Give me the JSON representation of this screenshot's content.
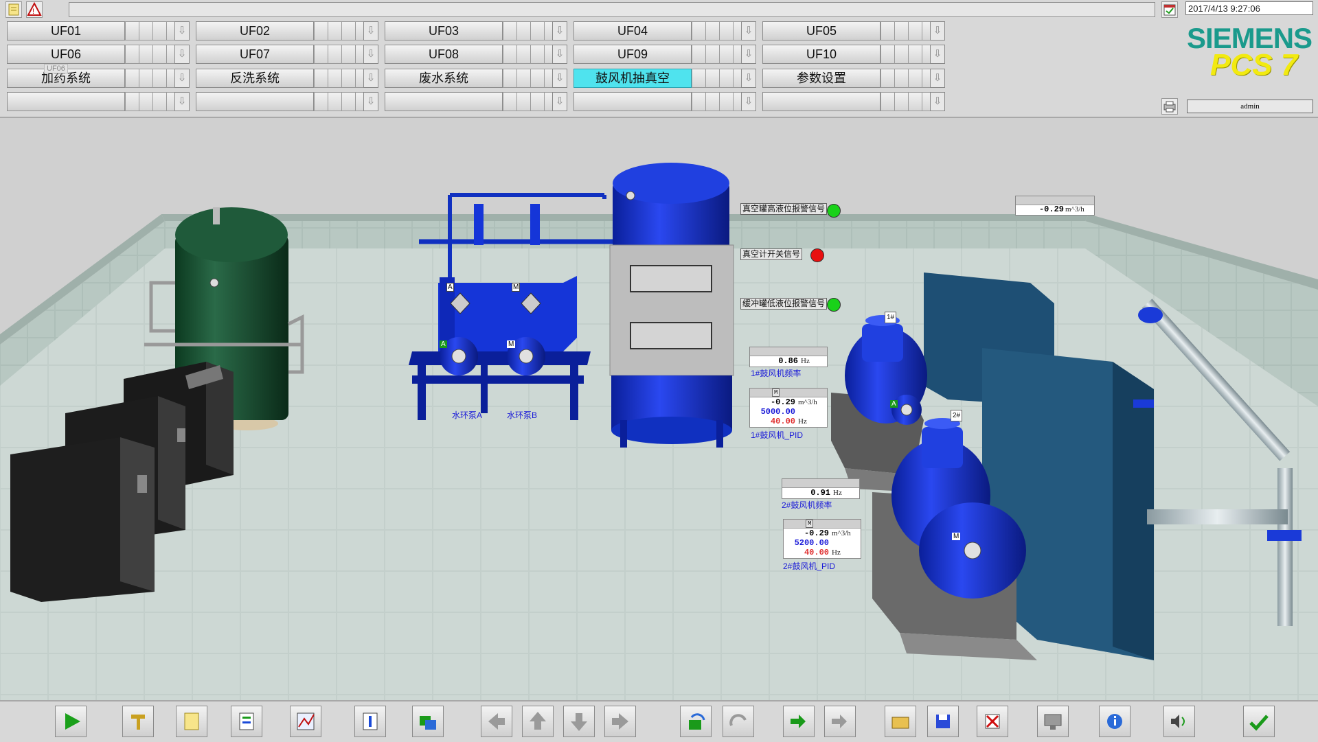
{
  "header": {
    "datetime": "2017/4/13 9:27:06",
    "user": "admin",
    "brand": "SIEMENS",
    "product": "PCS 7",
    "ghost_label": "UF06",
    "rows": [
      [
        "UF01",
        "UF02",
        "UF03",
        "UF04",
        "UF05"
      ],
      [
        "UF06",
        "UF07",
        "UF08",
        "UF09",
        "UF10"
      ],
      [
        "加药系统",
        "反洗系统",
        "废水系统",
        "鼓风机抽真空",
        "参数设置"
      ],
      [
        "",
        "",
        "",
        "",
        ""
      ]
    ],
    "active_button": "鼓风机抽真空"
  },
  "plant": {
    "signals": {
      "vacuum_high_level": "真空罐高液位报警信号",
      "vacuum_switch": "真空计开关信号",
      "buffer_low_level": "缓冲罐低液位报警信号"
    },
    "signal_colors": {
      "green": "#19d219",
      "red": "#e81010"
    },
    "pump_a_label": "水环泵A",
    "pump_b_label": "水环泵B",
    "flow_top": {
      "value": "-0.29",
      "unit": "m^3/h"
    },
    "blower1": {
      "tag": "1#",
      "freq_value": "0.86",
      "freq_unit": "Hz",
      "freq_label": "1#鼓风机频率",
      "pid_pv": "-0.29",
      "pid_pv_unit": "m^3/h",
      "pid_sp": "5000.00",
      "pid_out": "40.00",
      "pid_out_unit": "Hz",
      "pid_label": "1#鼓风机_PID",
      "mode": "M"
    },
    "blower2": {
      "tag": "2#",
      "freq_value": "0.91",
      "freq_unit": "Hz",
      "freq_label": "2#鼓风机频率",
      "pid_pv": "-0.29",
      "pid_pv_unit": "m^3/h",
      "pid_sp": "5200.00",
      "pid_out": "40.00",
      "pid_out_unit": "Hz",
      "pid_label": "2#鼓风机_PID",
      "mode": "M"
    },
    "motor_letters": {
      "a": "A",
      "m": "M"
    }
  },
  "toolbar": [
    "play-icon",
    "wrench-icon",
    "note-icon",
    "report-icon",
    "trend-icon",
    "thermometer-icon",
    "screen-swap-icon",
    "arrow-left-icon",
    "arrow-up-icon",
    "arrow-down-icon",
    "arrow-right-icon",
    "refresh-icon",
    "redo-icon",
    "import-icon",
    "export-icon",
    "open-folder-icon",
    "save-icon",
    "delete-icon",
    "monitor-icon",
    "info-icon",
    "sound-icon",
    "acknowledge-icon"
  ]
}
